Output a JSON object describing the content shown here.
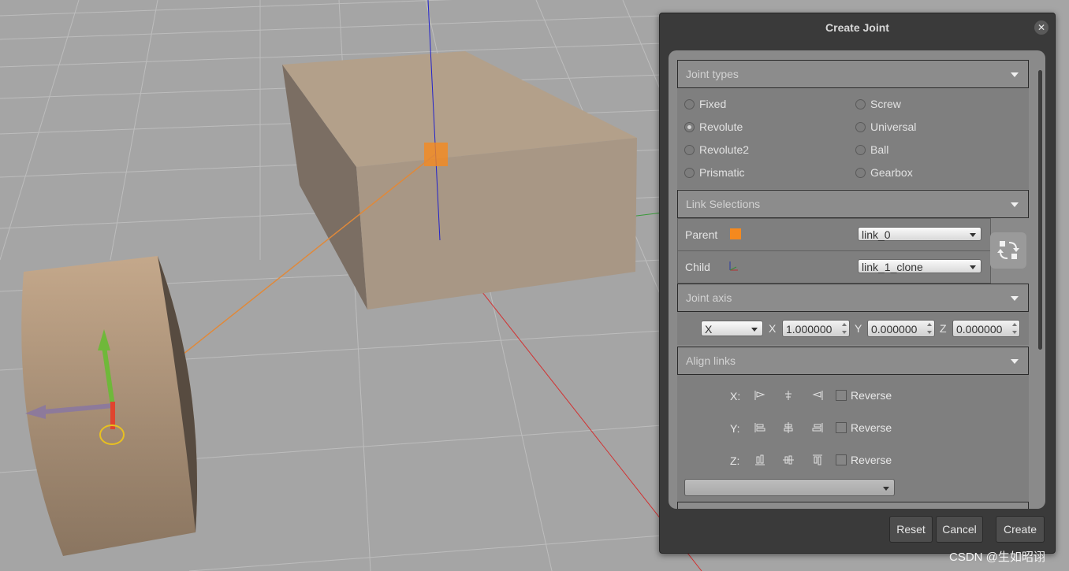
{
  "dialog": {
    "title": "Create Joint",
    "close_icon": "close-icon"
  },
  "joint_types": {
    "header": "Joint types",
    "selected": "Revolute",
    "left": [
      "Fixed",
      "Revolute",
      "Revolute2",
      "Prismatic"
    ],
    "right": [
      "Screw",
      "Universal",
      "Ball",
      "Gearbox"
    ]
  },
  "link_selections": {
    "header": "Link Selections",
    "parent_label": "Parent",
    "parent_value": "link_0",
    "child_label": "Child",
    "child_value": "link_1_clone",
    "swap_icon": "swap-icon"
  },
  "joint_axis": {
    "header": "Joint axis",
    "preset": "X",
    "x_label": "X",
    "x_value": "1.000000",
    "y_label": "Y",
    "y_value": "0.000000",
    "z_label": "Z",
    "z_value": "0.000000"
  },
  "align_links": {
    "header": "Align links",
    "rows": [
      {
        "axis": "X:",
        "reverse": "Reverse"
      },
      {
        "axis": "Y:",
        "reverse": "Reverse"
      },
      {
        "axis": "Z:",
        "reverse": "Reverse"
      }
    ]
  },
  "buttons": {
    "reset": "Reset",
    "cancel": "Cancel",
    "create": "Create"
  },
  "watermark": "CSDN @生如昭诩",
  "colors": {
    "parent_swatch": "#f5891e",
    "dialog_bg": "#3a3a3a",
    "panel_bg": "#8a8a8a"
  }
}
